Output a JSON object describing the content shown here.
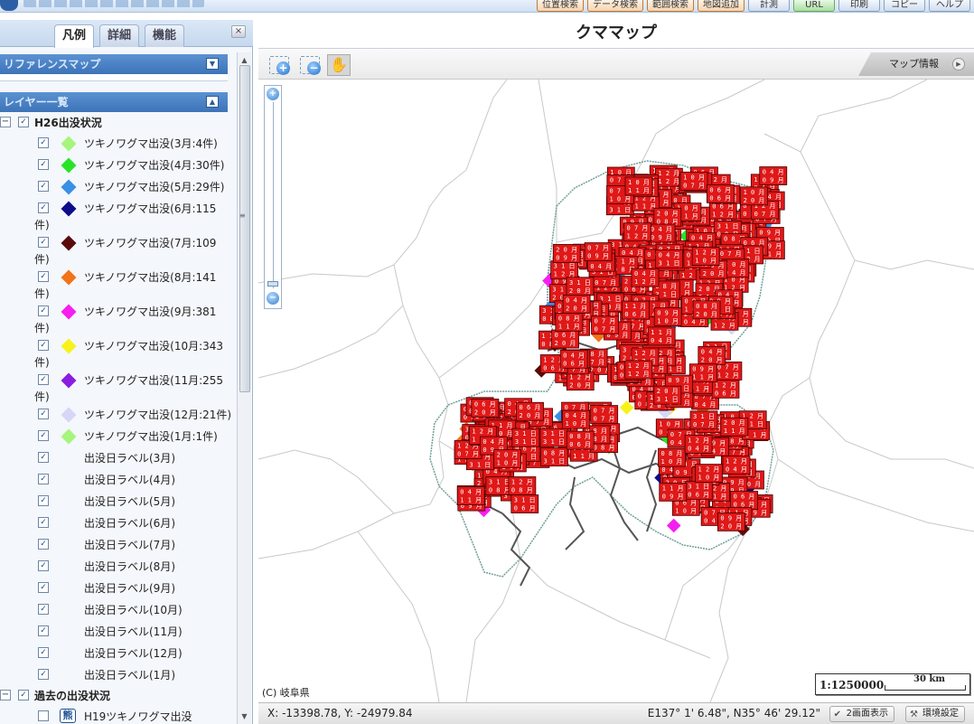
{
  "top_toolbar": {
    "buttons": [
      "位置検索",
      "データ検索",
      "範囲検索",
      "地図追加",
      "計測",
      "URL",
      "印刷",
      "コピー",
      "ヘルプ"
    ]
  },
  "left_panel": {
    "tabs": [
      "凡例",
      "詳細",
      "機能"
    ],
    "close_label": "×",
    "reference_map": {
      "title": "リファレンスマップ",
      "toggle": "▼"
    },
    "layer_list": {
      "title": "レイヤー一覧",
      "toggle": "▲",
      "group_h26": {
        "expander": "−",
        "label": "H26出没状況",
        "items": [
          {
            "line1": "ツキノワグマ出没(3月:4件)",
            "line2": "",
            "color": "#a6f57c"
          },
          {
            "line1": "ツキノワグマ出没(4月:30件)",
            "line2": "",
            "color": "#28e428"
          },
          {
            "line1": "ツキノワグマ出没(5月:29件)",
            "line2": "",
            "color": "#3a90e4"
          },
          {
            "line1": "ツキノワグマ出没(6月:115",
            "line2": "件)",
            "color": "#0c0c8c"
          },
          {
            "line1": "ツキノワグマ出没(7月:109",
            "line2": "件)",
            "color": "#5a0c0c"
          },
          {
            "line1": "ツキノワグマ出没(8月:141",
            "line2": "件)",
            "color": "#f27318"
          },
          {
            "line1": "ツキノワグマ出没(9月:381",
            "line2": "件)",
            "color": "#f51ff0"
          },
          {
            "line1": "ツキノワグマ出没(10月:343",
            "line2": "件)",
            "color": "#f7f21a"
          },
          {
            "line1": "ツキノワグマ出没(11月:255",
            "line2": "件)",
            "color": "#8a1de0"
          },
          {
            "line1": "ツキノワグマ出没(12月:21件)",
            "line2": "",
            "color": "#d6d6f7"
          },
          {
            "line1": "ツキノワグマ出没(1月:1件)",
            "line2": "",
            "color": "#a6f57c"
          }
        ],
        "labels": [
          "出没日ラベル(3月)",
          "出没日ラベル(4月)",
          "出没日ラベル(5月)",
          "出没日ラベル(6月)",
          "出没日ラベル(7月)",
          "出没日ラベル(8月)",
          "出没日ラベル(9月)",
          "出没日ラベル(10月)",
          "出没日ラベル(11月)",
          "出没日ラベル(12月)",
          "出没日ラベル(1月)"
        ]
      },
      "group_past": {
        "expander": "−",
        "label": "過去の出没状況",
        "items": [
          {
            "icon_text": "熊",
            "label": "H19ツキノワグマ出没"
          }
        ]
      }
    }
  },
  "map": {
    "title": "クママップ",
    "info_button": "マップ情報",
    "copyright": "(C) 岐阜県",
    "scale_ratio": "1:1250000",
    "scale_bar_label": "30 km",
    "status": {
      "xy": "X: -13398.78, Y: -24979.84",
      "lonlat": "E137° 1' 6.48\", N35° 46' 29.12\"",
      "dual_view": "2画面表示",
      "settings": "環境設定"
    },
    "marker_sample_labels": [
      "0 4 月",
      "1 0 月",
      "0 9 月",
      "1 1 月",
      "1 2 月",
      "0 8 月",
      "0 7 月",
      "0 6 月",
      "3 1 日",
      "2 0 月"
    ]
  }
}
